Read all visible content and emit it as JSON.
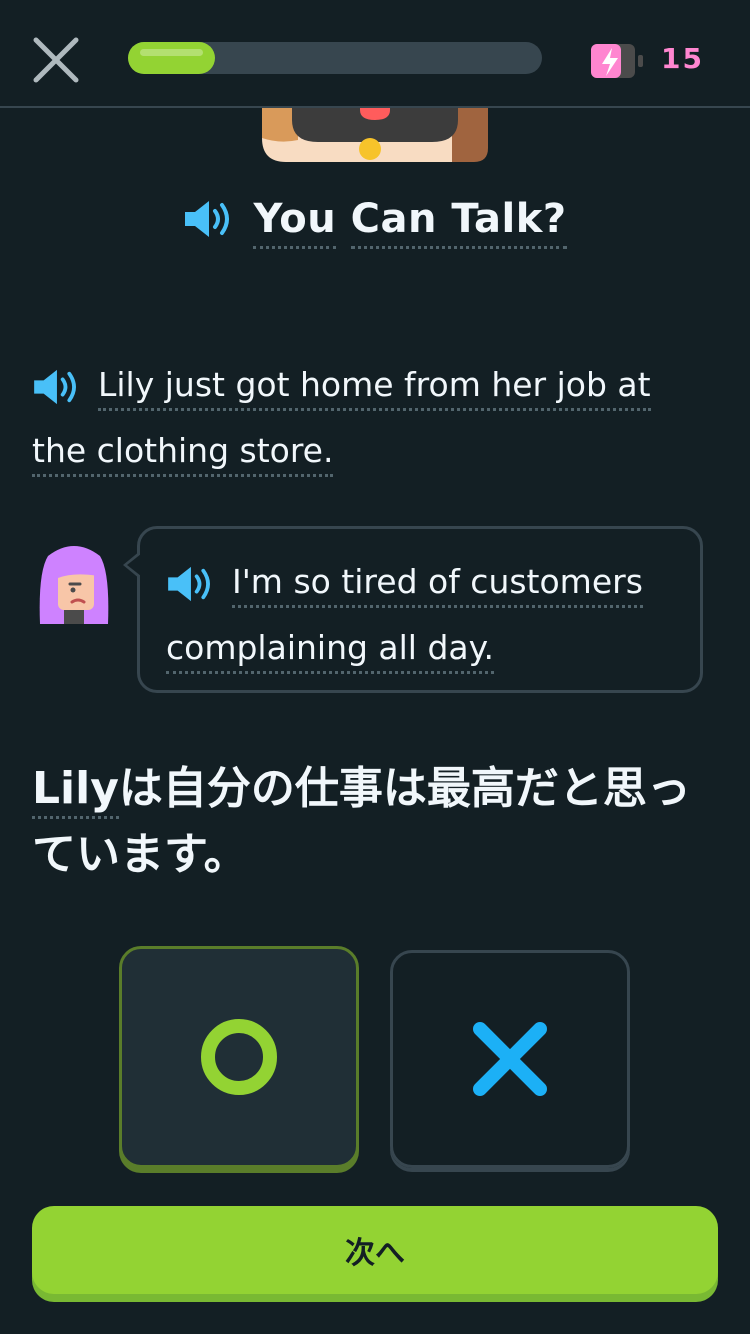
{
  "header": {
    "progress_percent": 21,
    "energy_count": "15",
    "colors": {
      "progress": "#93d333",
      "energy": "#ff86d0"
    }
  },
  "story": {
    "title_word_1": "You",
    "title_word_2": "Can Talk?",
    "narration_line_1": "Lily just got home from her job at",
    "narration_line_2": "the clothing store.",
    "bubble_line_1": "I'm so tired of customers",
    "bubble_line_2": "complaining all day."
  },
  "question": {
    "name": "Lily",
    "rest": "は自分の仕事は最高だと思っています。"
  },
  "choices": {
    "true_icon": "circle-icon",
    "false_icon": "cross-icon",
    "selected": "true"
  },
  "footer": {
    "next_label": "次へ"
  },
  "icons": [
    "close-icon",
    "energy-battery-icon",
    "speaker-icon",
    "lily-avatar",
    "mascot-image"
  ]
}
